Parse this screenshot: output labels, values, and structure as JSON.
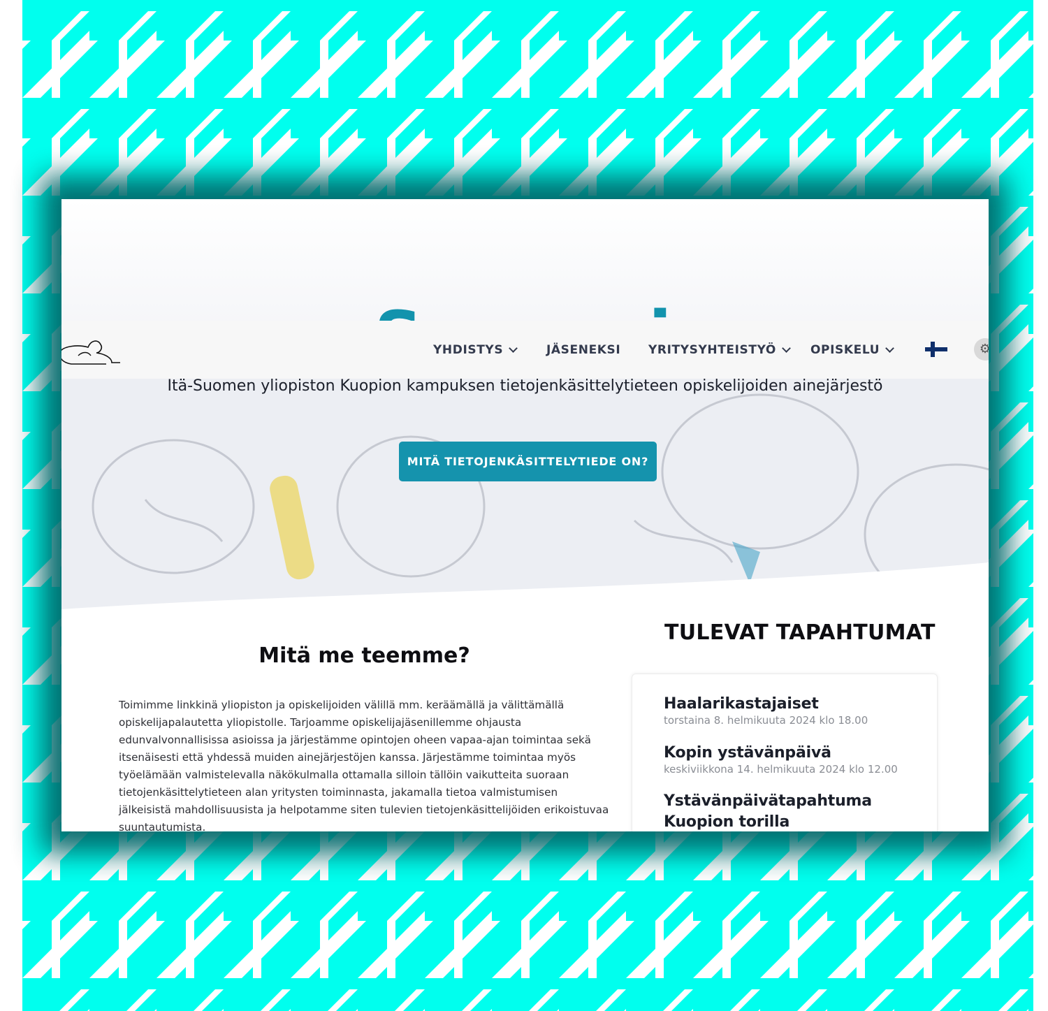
{
  "site": {
    "name": "Serveri",
    "tagline": "Itä-Suomen yliopiston Kuopion kampuksen tietojenkäsittelytieteen opiskelijoiden ainejärjestö",
    "cta_label": "MITÄ TIETOJENKÄSITTELYTIEDE ON?"
  },
  "nav": {
    "items": [
      {
        "label": "YHDISTYS",
        "has_dropdown": true
      },
      {
        "label": "JÄSENEKSI",
        "has_dropdown": false
      },
      {
        "label": "YRITYSYHTEISTYÖ",
        "has_dropdown": true
      },
      {
        "label": "OPISKELU",
        "has_dropdown": true
      }
    ],
    "language_icon": "finland-flag-icon",
    "settings_icon": "gear-icon"
  },
  "about": {
    "title": "Mitä me teemme?",
    "text": "Toimimme linkkinä yliopiston ja opiskelijoiden välillä mm. keräämällä ja välittämällä opiskelijapalautetta yliopistolle. Tarjoamme opiskelijajäsenillemme ohjausta edunvalvonnallisissa asioissa ja järjestämme opintojen oheen vapaa-ajan toimintaa sekä itsenäisesti että yhdessä muiden ainejärjestöjen kanssa. Järjestämme toimintaa myös työelämään valmistelevalla näkökulmalla ottamalla silloin tällöin vaikutteita suoraan tietojenkäsittelytieteen alan yritysten toiminnasta, jakamalla tietoa valmistumisen jälkeisistä mahdollisuusista ja helpotamme siten tulevien tietojenkäsittelijöiden erikoistuvaa suuntautumista."
  },
  "events": {
    "title": "TULEVAT TAPAHTUMAT",
    "items": [
      {
        "title": "Haalarikastajaiset",
        "date": "torstaina 8. helmikuuta 2024 klo 18.00"
      },
      {
        "title": "Kopin ystävänpäivä",
        "date": "keskiviikkona 14. helmikuuta 2024 klo 12.00"
      },
      {
        "title": "Ystävänpäivätapahtuma Kuopion torilla",
        "date": ""
      }
    ]
  },
  "colors": {
    "pattern_cyan": "#00ffee",
    "frame_shadow": "#00686a",
    "accent": "#1593ad",
    "nav_text": "#333a4d"
  }
}
